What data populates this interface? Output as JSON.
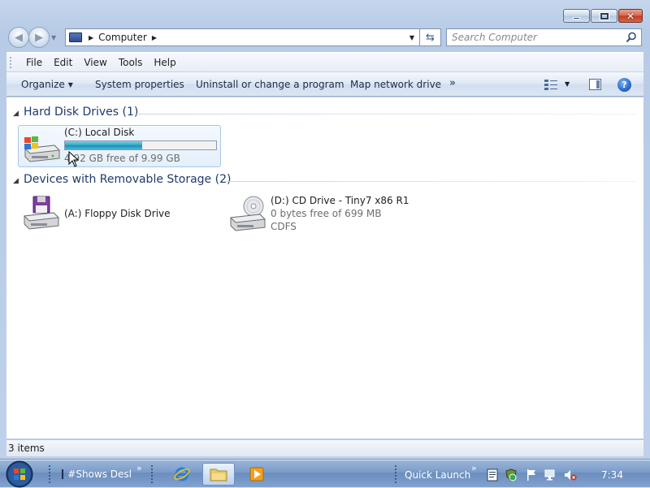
{
  "window": {
    "address_crumb": "Computer",
    "search_placeholder": "Search Computer"
  },
  "menu": [
    "File",
    "Edit",
    "View",
    "Tools",
    "Help"
  ],
  "commands": {
    "organize": "Organize",
    "system_properties": "System properties",
    "uninstall": "Uninstall or change a program",
    "map_drive": "Map network drive",
    "overflow": "»"
  },
  "groups": {
    "hard_disks": {
      "title": "Hard Disk Drives (1)",
      "items": [
        {
          "name": "(C:) Local Disk",
          "free": "4.92 GB free of 9.99 GB",
          "used_fraction": 0.51
        }
      ]
    },
    "removable": {
      "title": "Devices with Removable Storage (2)",
      "items": [
        {
          "name": "(A:) Floppy Disk Drive"
        },
        {
          "name": "(D:) CD Drive - Tiny7 x86 R1",
          "free": "0 bytes free of 699 MB",
          "fs": "CDFS"
        }
      ]
    }
  },
  "status": {
    "items": "3 items"
  },
  "taskbar": {
    "task1": "#Shows Desl",
    "quick_launch": "Quick Launch",
    "clock": "7:34"
  }
}
